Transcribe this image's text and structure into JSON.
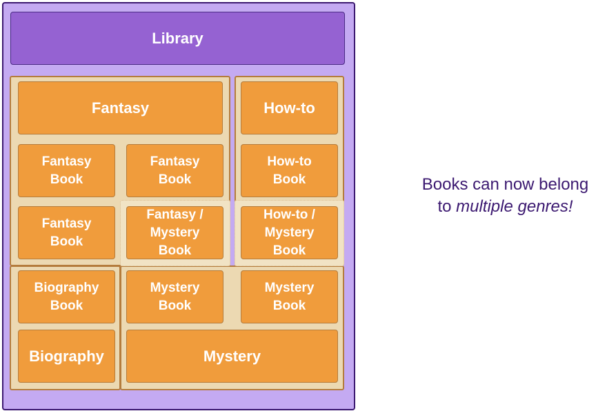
{
  "library": {
    "title": "Library"
  },
  "genres": {
    "fantasy": "Fantasy",
    "howto": "How-to",
    "biography": "Biography",
    "mystery": "Mystery"
  },
  "books": {
    "fantasy1": "Fantasy\nBook",
    "fantasy2": "Fantasy\nBook",
    "fantasy3": "Fantasy\nBook",
    "fantasy_mystery": "Fantasy /\nMystery\nBook",
    "howto1": "How-to\nBook",
    "howto_mystery": "How-to /\nMystery\nBook",
    "biography1": "Biography\nBook",
    "mystery1": "Mystery\nBook",
    "mystery2": "Mystery\nBook"
  },
  "note": {
    "line1": "Books can now belong",
    "line2_prefix": "to ",
    "line2_em": "multiple genres!"
  },
  "colors": {
    "library": "#c4aaf2",
    "header": "#9562d2",
    "group": "#ecd9b2",
    "book": "#f09c3c",
    "text": "#3b1870"
  }
}
